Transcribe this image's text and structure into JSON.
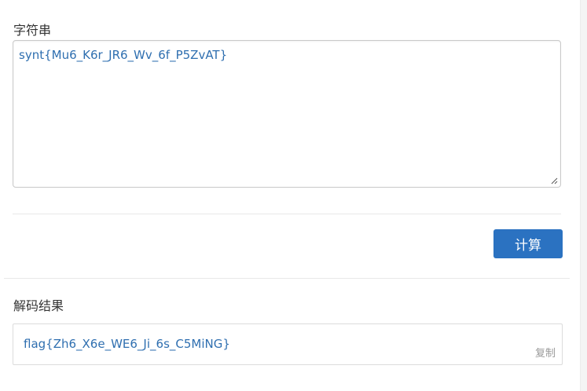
{
  "input": {
    "label": "字符串",
    "value": "synt{Mu6_K6r_JR6_Wv_6f_P5ZvAT}"
  },
  "actions": {
    "calculate_label": "计算",
    "button_color": "#2b72c1"
  },
  "result": {
    "label": "解码结果",
    "value": "flag{Zh6_X6e_WE6_Ji_6s_C5MiNG}",
    "copy_label": "复制"
  }
}
